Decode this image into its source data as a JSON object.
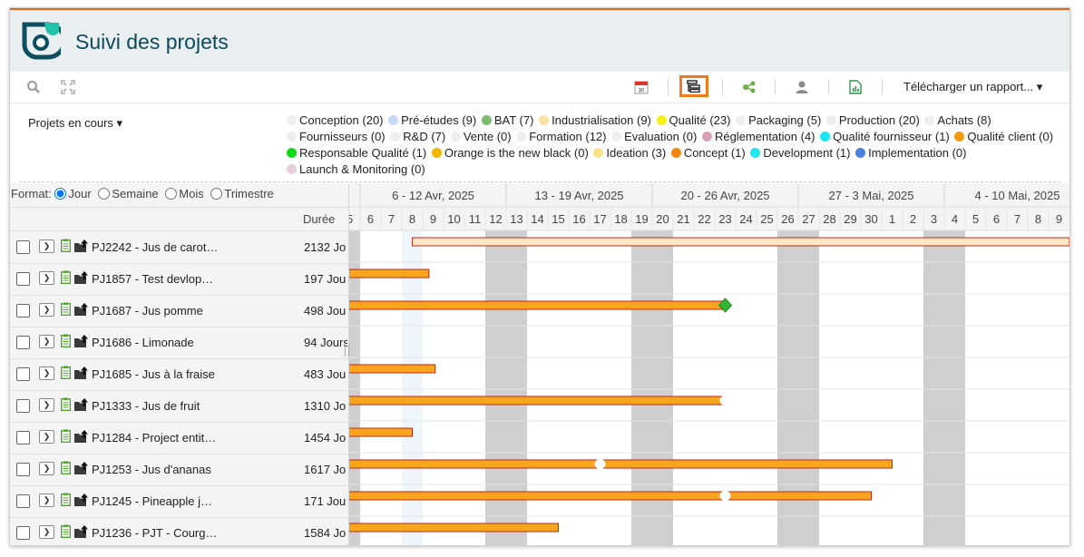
{
  "app": {
    "title": "Suivi des projets"
  },
  "toolbar": {
    "icons": [
      "search-icon",
      "fullscreen-icon",
      "calendar-icon",
      "tree-list-icon",
      "network-icon",
      "user-icon",
      "report-icon"
    ],
    "rapport_label": "Télécharger un rapport... ▾"
  },
  "filters": {
    "projets_label": "Projets en cours ▾",
    "legend": [
      {
        "label": "Conception (20)",
        "color": "#eeeeee"
      },
      {
        "label": "Pré-études (9)",
        "color": "#c7daf5"
      },
      {
        "label": "BAT (7)",
        "color": "#7dbb6e"
      },
      {
        "label": "Industrialisation (9)",
        "color": "#fbe1a3"
      },
      {
        "label": "Qualité (23)",
        "color": "#f6f01a"
      },
      {
        "label": "Packaging (5)",
        "color": "#eeeeee"
      },
      {
        "label": "Production (20)",
        "color": "#eeeeee"
      },
      {
        "label": "Achats (8)",
        "color": "#eeeeee"
      },
      {
        "label": "Fournisseurs (0)",
        "color": "#eeeeee"
      },
      {
        "label": "R&D (7)",
        "color": "#eeeeee"
      },
      {
        "label": "Vente (0)",
        "color": "#eeeeee"
      },
      {
        "label": "Formation (12)",
        "color": "#eeeeee"
      },
      {
        "label": "Evaluation (0)",
        "color": "#eeeeee"
      },
      {
        "label": "Réglementation (4)",
        "color": "#d8a1b5"
      },
      {
        "label": "Qualité fournisseur (1)",
        "color": "#1ce6f1"
      },
      {
        "label": "Qualité client (0)",
        "color": "#f39a12"
      },
      {
        "label": "Responsable Qualité (1)",
        "color": "#16d81a"
      },
      {
        "label": "Orange is the new black (0)",
        "color": "#f4b600"
      },
      {
        "label": "Ideation (3)",
        "color": "#f7e48a"
      },
      {
        "label": "Concept (1)",
        "color": "#f1860f"
      },
      {
        "label": "Development (1)",
        "color": "#1ce8ee"
      },
      {
        "label": "Implementation (0)",
        "color": "#4a80e0"
      },
      {
        "label": "Launch & Monitoring (0)",
        "color": "#e8cfdc"
      }
    ]
  },
  "format": {
    "label": "Format:",
    "options": [
      "Jour",
      "Semaine",
      "Mois",
      "Trimestre"
    ],
    "selected": "Jour"
  },
  "table": {
    "duration_header": "Durée",
    "rows": [
      {
        "name": "PJ2242 - Jus de carot…",
        "duration": "2132 Jo"
      },
      {
        "name": "PJ1857 - Test devlop…",
        "duration": "197 Jou"
      },
      {
        "name": "PJ1687 - Jus pomme",
        "duration": "498 Jou"
      },
      {
        "name": "PJ1686 - Limonade",
        "duration": "94 Jours"
      },
      {
        "name": "PJ1685 - Jus à la fraise",
        "duration": "483 Jou"
      },
      {
        "name": "PJ1333 - Jus de fruit",
        "duration": "1310 Jo"
      },
      {
        "name": "PJ1284 - Project entit…",
        "duration": "1454 Jo"
      },
      {
        "name": "PJ1253 - Jus d'ananas",
        "duration": "1617 Jo"
      },
      {
        "name": "PJ1245 - Pineapple j…",
        "duration": "171 Jou"
      },
      {
        "name": "PJ1236 - PJT - Courg…",
        "duration": "1584 Jo"
      }
    ]
  },
  "gantt": {
    "weeks": [
      "6 - 12 Avr, 2025",
      "13 - 19 Avr, 2025",
      "20 - 26 Avr, 2025",
      "27 - 3 Mai, 2025",
      "4 - 10 Mai, 2025"
    ],
    "days": [
      "5",
      "6",
      "7",
      "8",
      "9",
      "10",
      "11",
      "12",
      "13",
      "14",
      "15",
      "16",
      "17",
      "18",
      "19",
      "20",
      "21",
      "22",
      "23",
      "24",
      "25",
      "26",
      "27",
      "28",
      "29",
      "30",
      "1",
      "2",
      "3",
      "4",
      "5",
      "6",
      "7",
      "8",
      "9"
    ],
    "weekend_indices": [
      0,
      7,
      8,
      14,
      15,
      21,
      22,
      28,
      29
    ],
    "bar_color": "#f7a51d",
    "bar_border": "#c0281c",
    "milestone_color": "#2fb52f",
    "bars": [
      {
        "row": 0,
        "start": 3.5,
        "end": 35.0,
        "style": "light"
      },
      {
        "row": 1,
        "start": 0,
        "end": 4.3
      },
      {
        "row": 2,
        "start": 0,
        "end": 18.5,
        "milestone": 18.0,
        "milestone_type": "diamond"
      },
      {
        "row": 4,
        "start": 0,
        "end": 4.6
      },
      {
        "row": 5,
        "start": 0,
        "end": 18.5,
        "milestone": 18.0
      },
      {
        "row": 6,
        "start": 0,
        "end": 3.5
      },
      {
        "row": 7,
        "start": 0,
        "end": 26.5,
        "milestone": 12.0
      },
      {
        "row": 8,
        "start": 0,
        "end": 25.5,
        "milestone": 18.0
      },
      {
        "row": 9,
        "start": 0,
        "end": 10.5
      }
    ]
  }
}
